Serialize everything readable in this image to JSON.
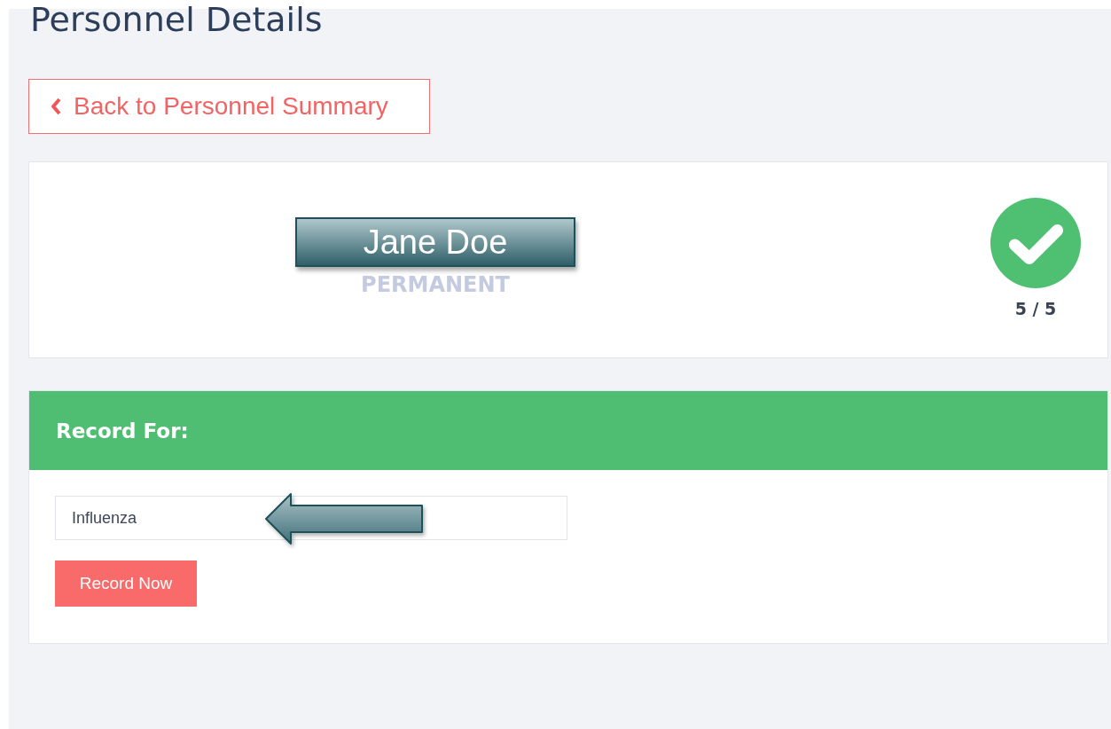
{
  "page": {
    "title": "Personnel Details"
  },
  "back_button": {
    "label": "Back to Personnel Summary"
  },
  "profile": {
    "name": "Jane Doe",
    "employment_type": "PERMANENT",
    "progress": "5 / 5"
  },
  "record_panel": {
    "heading": "Record For:",
    "field": {
      "value": "Influenza"
    },
    "button": "Record Now"
  }
}
